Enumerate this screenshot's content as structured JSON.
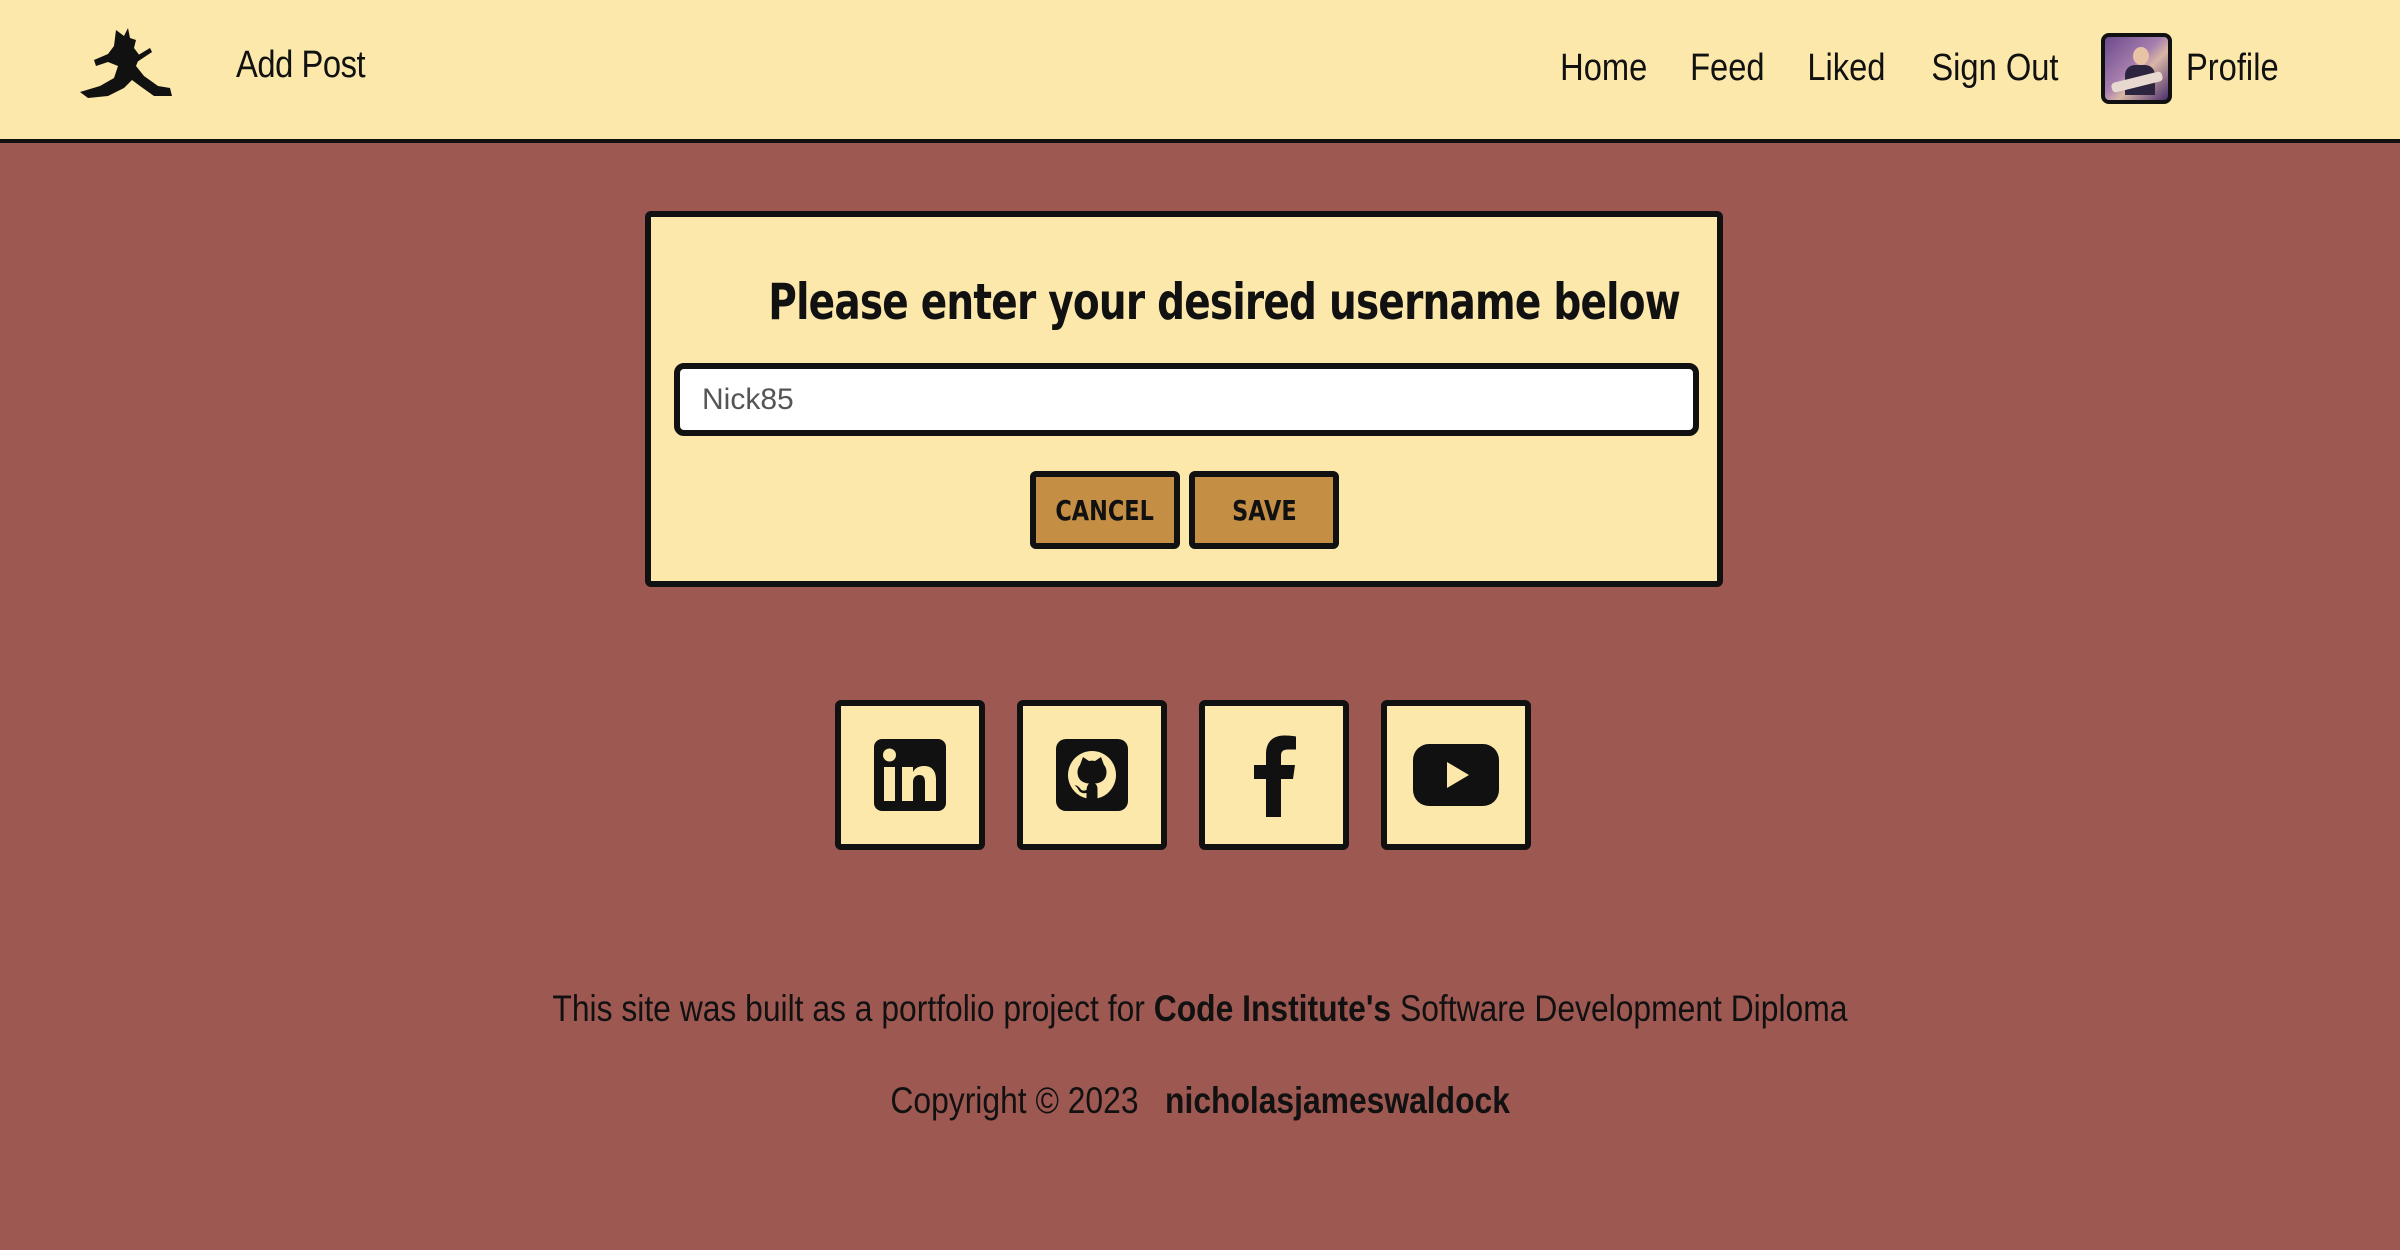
{
  "nav": {
    "add_post": "Add Post",
    "links": [
      "Home",
      "Feed",
      "Liked",
      "Sign Out"
    ],
    "profile": "Profile"
  },
  "card": {
    "title": "Please enter your desired username below",
    "username_value": "Nick85",
    "cancel": "CANCEL",
    "save": "SAVE"
  },
  "social": [
    "linkedin-icon",
    "github-icon",
    "facebook-icon",
    "youtube-icon"
  ],
  "footer": {
    "line1_prefix": "This site was built as a portfolio project for",
    "line1_bold": "Code Institute's",
    "line1_suffix": "Software Development Diploma",
    "copyright": "Copyright © 2023",
    "author": "nicholasjameswaldock"
  },
  "colors": {
    "page_bg": "#9e5852",
    "panel_bg": "#fbe8aa",
    "button_bg": "#c48e45",
    "border": "#111111"
  }
}
